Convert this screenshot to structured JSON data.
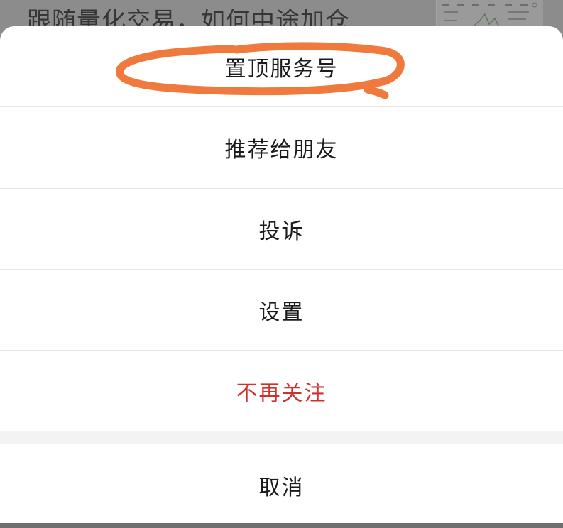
{
  "background": {
    "article_title": "跟随量化交易，如何中途加仓"
  },
  "action_sheet": {
    "items": [
      {
        "label": "置顶服务号",
        "danger": false
      },
      {
        "label": "推荐给朋友",
        "danger": false
      },
      {
        "label": "投诉",
        "danger": false
      },
      {
        "label": "设置",
        "danger": false
      },
      {
        "label": "不再关注",
        "danger": true
      }
    ],
    "cancel_label": "取消"
  },
  "colors": {
    "danger_text": "#d0302b",
    "annotation_oval": "#f07a3d"
  }
}
